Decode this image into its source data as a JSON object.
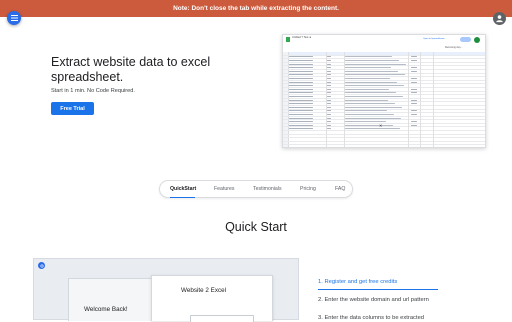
{
  "banner": {
    "text": "Note: Don't close the tab while extracting the content."
  },
  "colors": {
    "banner": "#cc5b3e",
    "primary": "#1a73e8",
    "fab": "#2a6be8"
  },
  "icons": {
    "menu": "hamburger-menu-icon",
    "account": "account-icon"
  },
  "hero": {
    "title": "Extract website data to excel spreadsheet.",
    "subtitle": "Start in 1 min. No Code Required.",
    "cta_label": "Free Trial"
  },
  "sheet_preview": {
    "doc_title": "Untitled ? Test ★",
    "header_link": "Open in Spreadsheets",
    "share_label": "Share",
    "formula_hint": "Removing dup..."
  },
  "tabs": [
    {
      "label": "QuickStart",
      "active": true
    },
    {
      "label": "Features",
      "active": false
    },
    {
      "label": "Testimonials",
      "active": false
    },
    {
      "label": "Pricing",
      "active": false
    },
    {
      "label": "FAQ",
      "active": false
    }
  ],
  "quickstart": {
    "heading": "Quick Start",
    "preview": {
      "welcome": "Welcome Back!",
      "app_title": "Website 2 Excel"
    },
    "steps": [
      {
        "label": "1. Register and get free credits",
        "active": true
      },
      {
        "label": "2. Enter the website domain and url pattern",
        "active": false
      },
      {
        "label": "3. Enter the data columns to be extracted",
        "active": false
      }
    ]
  }
}
